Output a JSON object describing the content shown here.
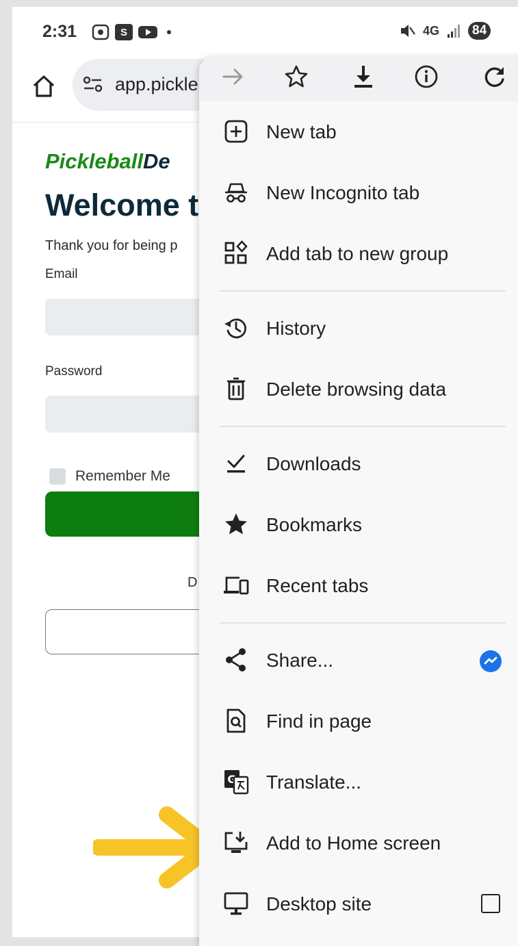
{
  "status_bar": {
    "time": "2:31",
    "icons": [
      "screen-record-icon",
      "s-app-icon",
      "youtube-icon",
      "dot-icon"
    ],
    "network": "4G",
    "battery": "84"
  },
  "toolbar": {
    "url": "app.pickle"
  },
  "page": {
    "brand_part1": "Pickleball",
    "brand_part2": "De",
    "welcome": "Welcome t",
    "thanks": "Thank you for being p",
    "email_label": "Email",
    "password_label": "Password",
    "remember_label": "Remember Me",
    "d_letter": "D"
  },
  "menu": {
    "top_icons": [
      "forward-icon",
      "bookmark-star-icon",
      "download-icon",
      "info-icon",
      "reload-icon"
    ],
    "items": [
      {
        "label": "New tab",
        "icon": "new-tab-icon"
      },
      {
        "label": "New Incognito tab",
        "icon": "incognito-icon"
      },
      {
        "label": "Add tab to new group",
        "icon": "tab-group-icon"
      },
      {
        "label": "History",
        "icon": "history-icon"
      },
      {
        "label": "Delete browsing data",
        "icon": "trash-icon"
      },
      {
        "label": "Downloads",
        "icon": "downloads-icon"
      },
      {
        "label": "Bookmarks",
        "icon": "bookmarks-star-icon"
      },
      {
        "label": "Recent tabs",
        "icon": "recent-tabs-icon"
      },
      {
        "label": "Share...",
        "icon": "share-icon"
      },
      {
        "label": "Find in page",
        "icon": "find-in-page-icon"
      },
      {
        "label": "Translate...",
        "icon": "translate-icon"
      },
      {
        "label": "Add to Home screen",
        "icon": "add-to-home-icon"
      },
      {
        "label": "Desktop site",
        "icon": "desktop-icon"
      }
    ]
  },
  "colors": {
    "brand_green": "#1a8a18",
    "brand_navy": "#0d2a3a",
    "login_green": "#0e7d10",
    "messenger_blue": "#1a73e8",
    "arrow_yellow": "#f7c428"
  }
}
